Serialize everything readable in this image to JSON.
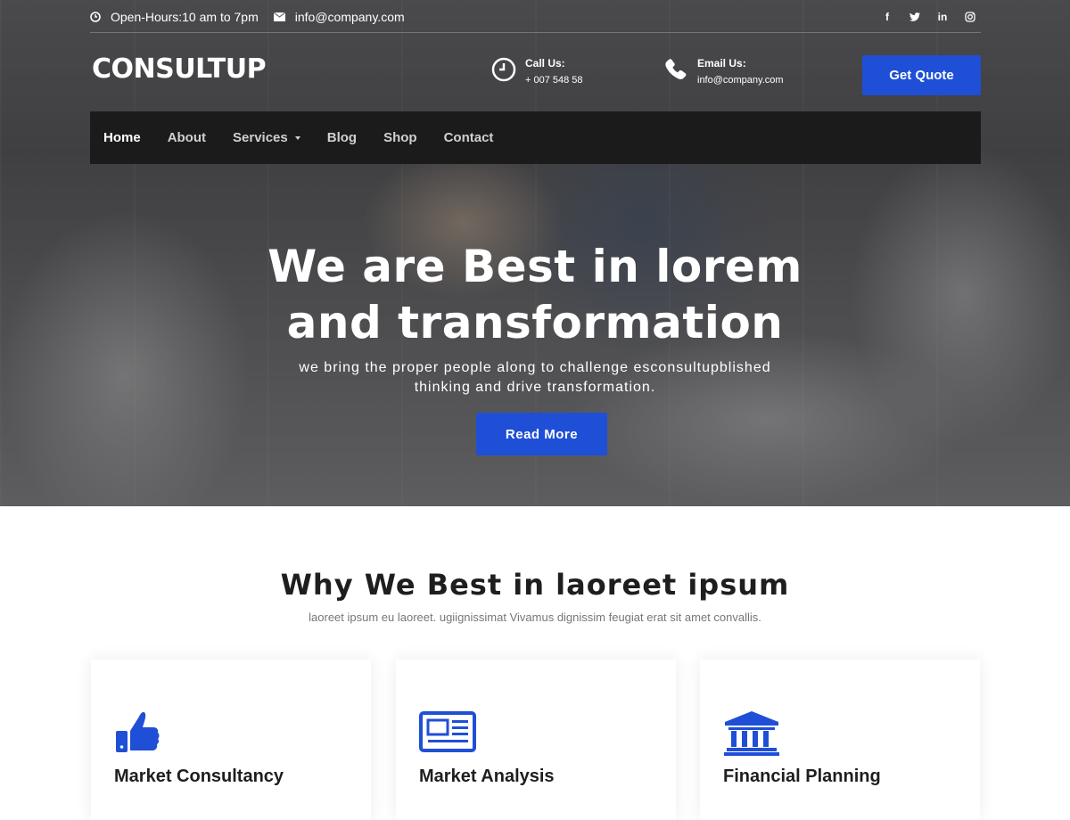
{
  "topbar": {
    "hours": "Open-Hours:10 am to 7pm",
    "email": "info@company.com",
    "social": [
      "f",
      "t",
      "in",
      "ig"
    ]
  },
  "header": {
    "logo": "CONSULTUP",
    "call_label": "Call Us:",
    "call_value": "+ 007 548 58",
    "email_label": "Email Us:",
    "email_value": "info@company.com",
    "quote_button": "Get Quote"
  },
  "nav": {
    "items": [
      {
        "label": "Home",
        "active": true
      },
      {
        "label": "About"
      },
      {
        "label": "Services",
        "dropdown": true
      },
      {
        "label": "Blog"
      },
      {
        "label": "Shop"
      },
      {
        "label": "Contact"
      }
    ]
  },
  "hero": {
    "title_line1": "We are Best in lorem",
    "title_line2": "and transformation",
    "subtitle_line1": "we bring the proper people along to challenge esconsultupblished",
    "subtitle_line2": "thinking and drive transformation.",
    "button": "Read More"
  },
  "why": {
    "title": "Why We Best in laoreet ipsum",
    "subtitle": "laoreet ipsum eu laoreet. ugiignissimat Vivamus dignissim feugiat erat sit amet convallis.",
    "cards": [
      {
        "title": "Market Consultancy",
        "icon": "thumbs-up-icon"
      },
      {
        "title": "Market Analysis",
        "icon": "newspaper-icon"
      },
      {
        "title": "Financial Planning",
        "icon": "bank-icon"
      }
    ]
  },
  "colors": {
    "accent": "#1f4fd6",
    "nav_bg": "#181818",
    "heading": "#1e1e1e"
  }
}
